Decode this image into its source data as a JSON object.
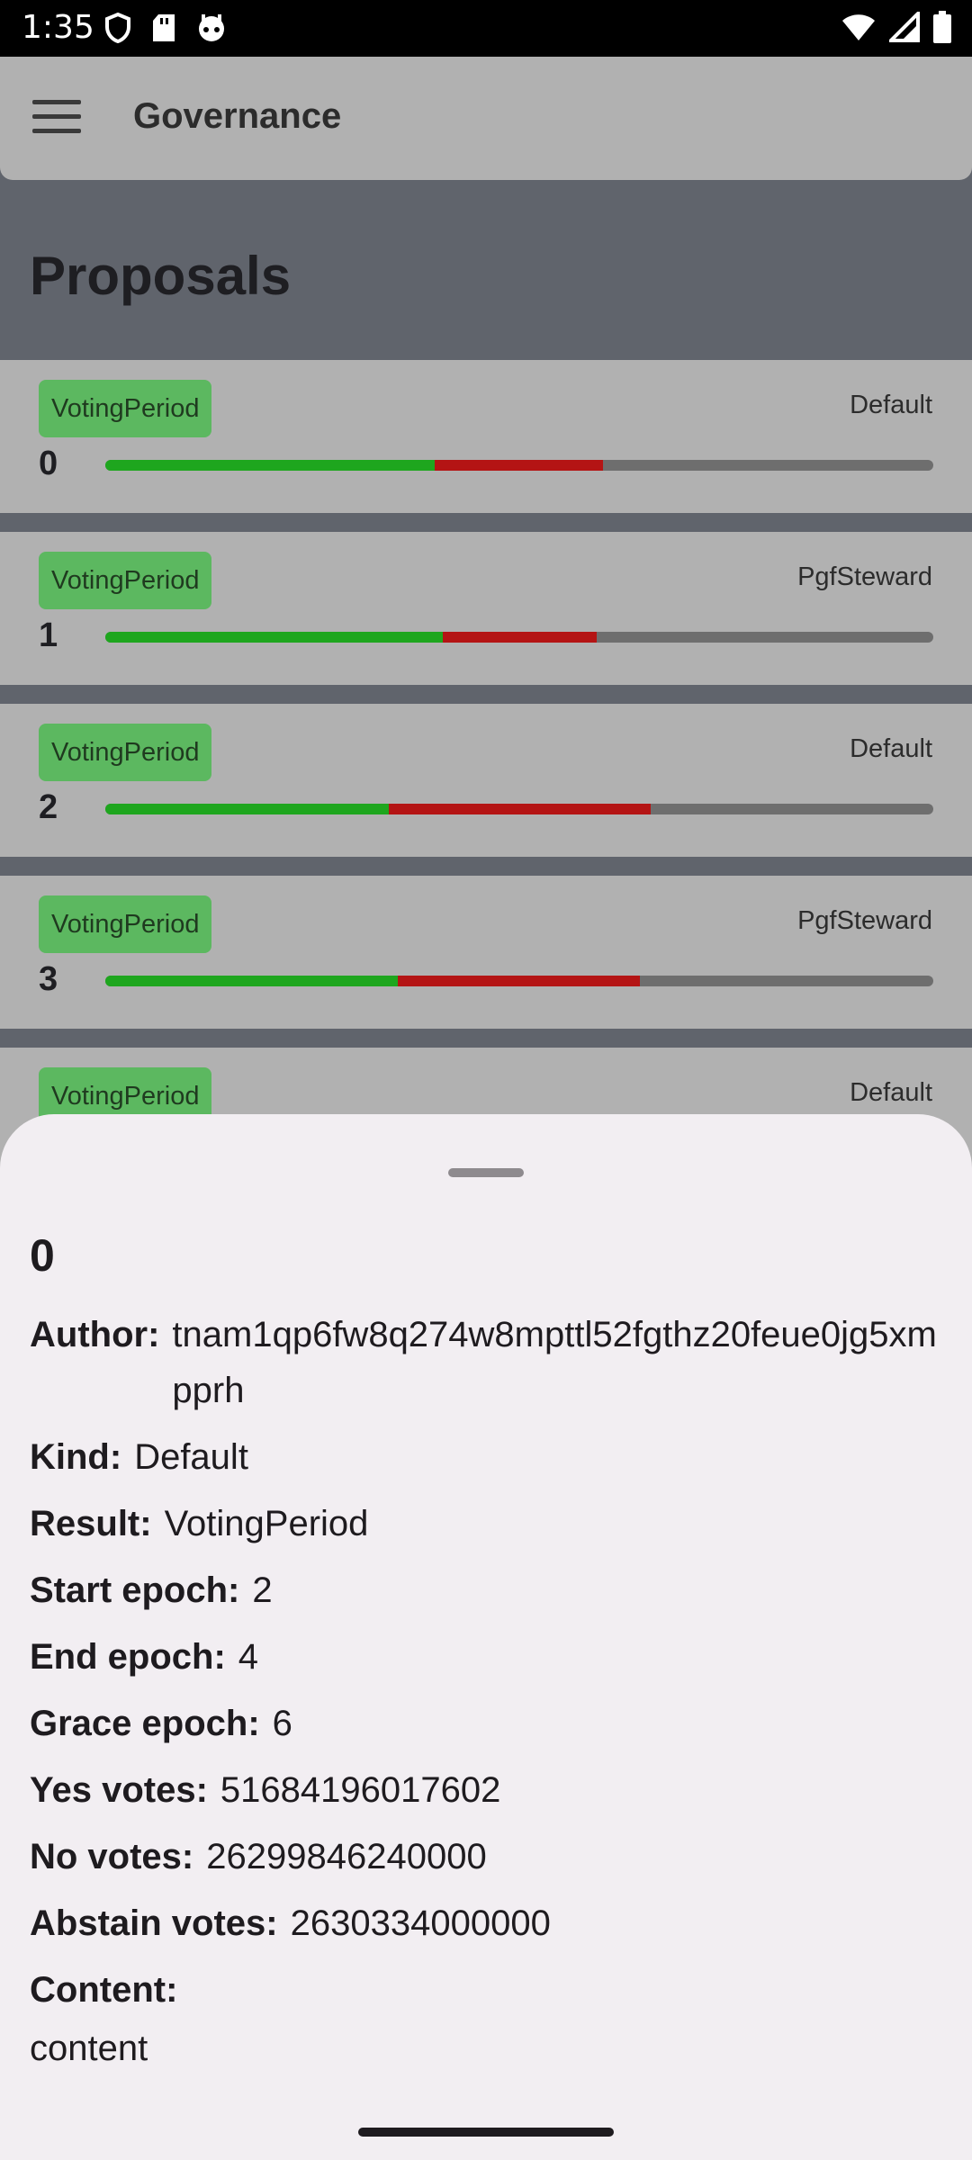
{
  "status_bar": {
    "time": "1:35",
    "left_icons": [
      "shield-icon",
      "sd-card-icon",
      "robot-icon"
    ],
    "right_icons": [
      "wifi-icon",
      "signal-icon",
      "battery-icon"
    ]
  },
  "app_bar": {
    "title": "Governance",
    "menu_icon": "hamburger-menu-icon"
  },
  "section": {
    "title": "Proposals"
  },
  "colors": {
    "yes": "#1ea61e",
    "no": "#b41414",
    "badge": "#5cb860",
    "scrim": "#60646c"
  },
  "proposals": [
    {
      "id": "0",
      "status": "VotingPeriod",
      "kind": "Default",
      "yes_fraction": 0.398,
      "no_fraction": 0.203
    },
    {
      "id": "1",
      "status": "VotingPeriod",
      "kind": "PgfSteward",
      "yes_fraction": 0.408,
      "no_fraction": 0.185
    },
    {
      "id": "2",
      "status": "VotingPeriod",
      "kind": "Default",
      "yes_fraction": 0.342,
      "no_fraction": 0.317
    },
    {
      "id": "3",
      "status": "VotingPeriod",
      "kind": "PgfSteward",
      "yes_fraction": 0.353,
      "no_fraction": 0.293
    },
    {
      "id": "",
      "status": "VotingPeriod",
      "kind": "Default"
    }
  ],
  "details": {
    "title": "0",
    "author_label": "Author:",
    "author": "tnam1qp6fw8q274w8mpttl52fgthz20feue0jg5xmpprh",
    "kind_label": "Kind:",
    "kind": "Default",
    "result_label": "Result:",
    "result": "VotingPeriod",
    "start_epoch_label": "Start epoch:",
    "start_epoch": "2",
    "end_epoch_label": "End epoch:",
    "end_epoch": "4",
    "grace_epoch_label": "Grace epoch:",
    "grace_epoch": "6",
    "yes_votes_label": "Yes votes:",
    "yes_votes": "51684196017602",
    "no_votes_label": "No votes:",
    "no_votes": "26299846240000",
    "abstain_votes_label": "Abstain votes:",
    "abstain_votes": "2630334000000",
    "content_label": "Content:",
    "content": "content"
  }
}
